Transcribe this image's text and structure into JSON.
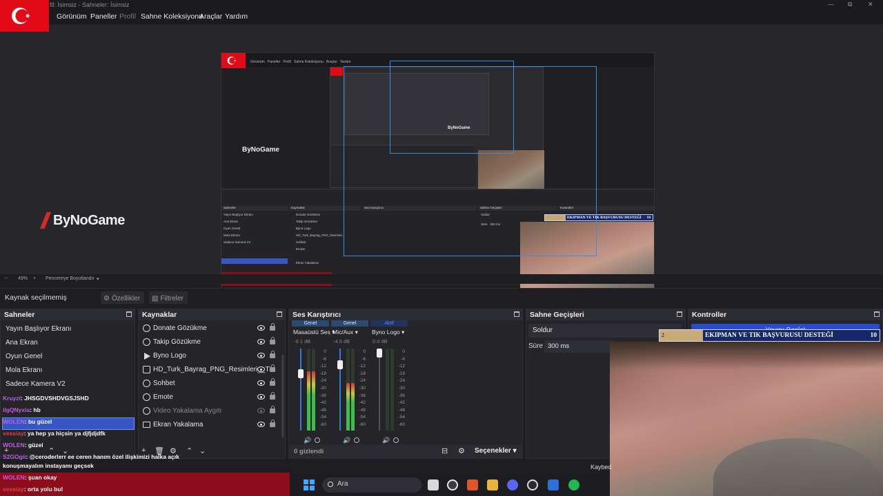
{
  "window": {
    "title": "fil: İsimsiz - Sahneler: İsimsiz"
  },
  "menu": {
    "items": [
      "Görünüm",
      "Paneller",
      "Profil",
      "Sahne Koleksiyonu",
      "Araçlar",
      "Yardım"
    ]
  },
  "preview": {
    "brand": "ByNoGame",
    "nested_brand": "ByNoGame",
    "canvas_brand": "ByNoGame",
    "ticker_text": "EKIPMAN VE TIK BAŞVURUSU DESTEĞİ",
    "ticker_number": "10"
  },
  "zoom": {
    "level": "49%",
    "mode": "Pencereye Boyutlandır"
  },
  "source_bar": {
    "no_source": "Kaynak seçilmemiş",
    "properties": "Özellikler",
    "filters": "Filtreler"
  },
  "scenes": {
    "title": "Sahneler",
    "items": [
      "Yayın Başlıyor Ekranı",
      "Ana Ekran",
      "Oyun Genel",
      "Mola Ekranı",
      "Sadece Kamera V2"
    ]
  },
  "sources": {
    "title": "Kaynaklar",
    "items": [
      {
        "label": "Donate Gözükme",
        "icon": "globe-icon",
        "visible": true
      },
      {
        "label": "Takip Gözükme",
        "icon": "globe-icon",
        "visible": true
      },
      {
        "label": "Byno Logo",
        "icon": "play-icon",
        "visible": true
      },
      {
        "label": "HD_Turk_Bayrag_PNG_Resimleri__Ti",
        "icon": "image-icon",
        "visible": true
      },
      {
        "label": "Sohbet",
        "icon": "globe-icon",
        "visible": true
      },
      {
        "label": "Emote",
        "icon": "globe-icon",
        "visible": true
      },
      {
        "label": "Video Yakalama Aygıtı",
        "icon": "camera-icon",
        "visible": false
      },
      {
        "label": "Ekran Yakalama",
        "icon": "monitor-icon",
        "visible": true
      }
    ]
  },
  "mixer": {
    "title": "Ses Karıştırıcı",
    "channels": [
      {
        "tag": "Genel",
        "name": "Masaüstü Ses",
        "db": "-9.1 dB",
        "level": 0.72,
        "fader": 0.72,
        "active": false,
        "muted": false
      },
      {
        "tag": "Genel",
        "name": "Mic/Aux",
        "db": "-4.5 dB",
        "level": 0.58,
        "fader": 0.84,
        "active": false,
        "muted": false
      },
      {
        "tag": "Aktif",
        "name": "Byno Logo",
        "db": "0.0 dB",
        "level": 0.0,
        "fader": 1.0,
        "active": true,
        "muted": true
      }
    ],
    "scale": [
      "0",
      "-6",
      "-12",
      "-18",
      "-24",
      "-30",
      "-36",
      "-42",
      "-48",
      "-54",
      "-60"
    ],
    "hidden": "0 gizlendi",
    "options": "Seçenekler"
  },
  "transitions": {
    "title": "Sahne Geçişleri",
    "selected": "Soldur",
    "duration_label": "Süre",
    "duration_value": "300 ms"
  },
  "controls": {
    "title": "Kontroller",
    "start_label": "Yayını Başlat",
    "other_label": "Kaybed"
  },
  "ticker": {
    "left": "2",
    "text": "EKIPMAN VE TIK BAŞVURUSU DESTEĞİ",
    "number": "10"
  },
  "chat": {
    "messages": [
      {
        "user": "Kruyzl",
        "text": ": JHSGDVSHDVGSJSHD",
        "color": "purple"
      },
      {
        "user": "ilgQNyxia",
        "text": ": hb",
        "color": "purple"
      },
      {
        "user": "WOLEN",
        "text": ": bu güzel",
        "color": "purple"
      },
      {
        "user": "vessiay",
        "text": ": ya hep ya hiçsin ya djfjdjdfk",
        "color": "red"
      },
      {
        "user": "WOLEN",
        "text": ": güzel",
        "color": "purple"
      },
      {
        "user": "S2GOgii",
        "text": ": @ceroderlerr ee ceren hanım özel ilişkimizi halka açık",
        "color": "purple"
      },
      {
        "user": "",
        "text": "konuşmayalım instayamı geçsek",
        "color": "purple"
      },
      {
        "user": "WOLEN",
        "text": ": şuan okay",
        "color": "purple"
      },
      {
        "user": "vessiay",
        "text": ": orta yolu bul",
        "color": "red"
      }
    ]
  },
  "taskbar": {
    "search_placeholder": "Ara"
  },
  "colors": {
    "accent": "#3656c6",
    "flag": "#e30a17",
    "chat_strip": "#8d0d1c",
    "ticker": "#14286a"
  }
}
